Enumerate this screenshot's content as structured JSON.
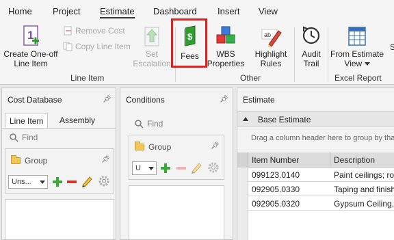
{
  "menu": {
    "tabs": [
      "Home",
      "Project",
      "Estimate",
      "Dashboard",
      "Insert",
      "View"
    ],
    "active": "Estimate"
  },
  "ribbon": {
    "create_oneoff": [
      "Create One-off",
      "Line Item"
    ],
    "remove_cost": "Remove Cost",
    "copy_line_item": "Copy Line Item",
    "set_escalation": [
      "Set",
      "Escalation"
    ],
    "fees": "Fees",
    "wbs_properties": [
      "WBS",
      "Properties"
    ],
    "highlight_rules": [
      "Highlight",
      "Rules"
    ],
    "audit_trail": [
      "Audit",
      "Trail"
    ],
    "from_estimate_view": [
      "From Estimate",
      "View"
    ],
    "partial_right": "S",
    "groups": {
      "line_item": "Line Item",
      "other": "Other",
      "excel_report": "Excel Report"
    },
    "colors": {
      "highlight": "#e2211c",
      "fees_icon": "#2f9e2f"
    }
  },
  "cost_database": {
    "title": "Cost Database",
    "tabs": [
      "Line Item",
      "Assembly"
    ],
    "active_tab": "Line Item",
    "find_placeholder": "Find",
    "group_label": "Group",
    "dropdown_value": "Uns..."
  },
  "conditions": {
    "title": "Conditions",
    "find_placeholder": "Find",
    "group_label": "Group",
    "dropdown_value": "U"
  },
  "estimate": {
    "title": "Estimate",
    "base_label": "Base Estimate",
    "drag_hint": "Drag a column header here to group by tha",
    "columns": [
      "Item Number",
      "Description"
    ],
    "rows": [
      {
        "item": "099123.0140",
        "desc": "Paint ceilings; rol"
      },
      {
        "item": "092905.0330",
        "desc": "Taping and finish"
      },
      {
        "item": "092905.0320",
        "desc": "Gypsum Ceiling,"
      }
    ]
  }
}
